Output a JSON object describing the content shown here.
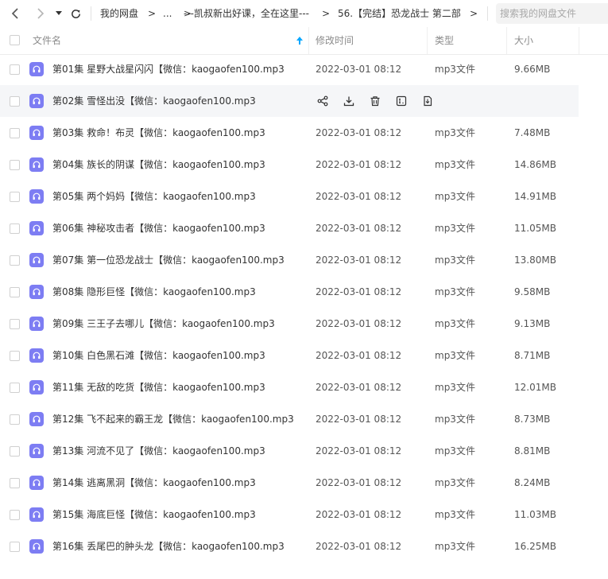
{
  "nav": {
    "breadcrumb": [
      {
        "label": "我的网盘"
      },
      {
        "label": "..."
      },
      {
        "label": "---凯叔新出好课，全在这里---"
      },
      {
        "label": "56.【完结】恐龙战士 第二部"
      }
    ],
    "separator": ">",
    "search_placeholder": "搜索我的网盘文件"
  },
  "table": {
    "columns": {
      "name": "文件名",
      "modified": "修改时间",
      "type": "类型",
      "size": "大小"
    },
    "sort": {
      "column": "name",
      "direction": "asc"
    },
    "hovered_row_index": 1,
    "hover_actions": [
      "share-icon",
      "download-icon",
      "delete-icon",
      "rename-icon",
      "more-icon"
    ],
    "rows": [
      {
        "name": "第01集 星野大战星闪闪【微信：kaogaofen100.mp3",
        "modified": "2022-03-01 08:12",
        "type": "mp3文件",
        "size": "9.66MB"
      },
      {
        "name": "第02集 雪怪出没【微信：kaogaofen100.mp3",
        "modified": "2022-03-01 08:12",
        "type": "mp3文件",
        "size": ""
      },
      {
        "name": "第03集 救命！布灵【微信：kaogaofen100.mp3",
        "modified": "2022-03-01 08:12",
        "type": "mp3文件",
        "size": "7.48MB"
      },
      {
        "name": "第04集 族长的阴谋【微信：kaogaofen100.mp3",
        "modified": "2022-03-01 08:12",
        "type": "mp3文件",
        "size": "14.86MB"
      },
      {
        "name": "第05集 两个妈妈【微信：kaogaofen100.mp3",
        "modified": "2022-03-01 08:12",
        "type": "mp3文件",
        "size": "14.91MB"
      },
      {
        "name": "第06集 神秘攻击者【微信：kaogaofen100.mp3",
        "modified": "2022-03-01 08:12",
        "type": "mp3文件",
        "size": "11.05MB"
      },
      {
        "name": "第07集 第一位恐龙战士【微信：kaogaofen100.mp3",
        "modified": "2022-03-01 08:12",
        "type": "mp3文件",
        "size": "13.80MB"
      },
      {
        "name": "第08集 隐形巨怪【微信：kaogaofen100.mp3",
        "modified": "2022-03-01 08:12",
        "type": "mp3文件",
        "size": "9.58MB"
      },
      {
        "name": "第09集 三王子去哪儿【微信：kaogaofen100.mp3",
        "modified": "2022-03-01 08:12",
        "type": "mp3文件",
        "size": "9.13MB"
      },
      {
        "name": "第10集 白色黑石滩【微信：kaogaofen100.mp3",
        "modified": "2022-03-01 08:12",
        "type": "mp3文件",
        "size": "8.71MB"
      },
      {
        "name": "第11集  无敌的吃货【微信：kaogaofen100.mp3",
        "modified": "2022-03-01 08:12",
        "type": "mp3文件",
        "size": "12.01MB"
      },
      {
        "name": "第12集 飞不起来的霸王龙【微信：kaogaofen100.mp3",
        "modified": "2022-03-01 08:12",
        "type": "mp3文件",
        "size": "8.73MB"
      },
      {
        "name": "第13集 河流不见了【微信：kaogaofen100.mp3",
        "modified": "2022-03-01 08:12",
        "type": "mp3文件",
        "size": "8.81MB"
      },
      {
        "name": "第14集 逃离黑洞【微信：kaogaofen100.mp3",
        "modified": "2022-03-01 08:12",
        "type": "mp3文件",
        "size": "8.24MB"
      },
      {
        "name": "第15集 海底巨怪【微信：kaogaofen100.mp3",
        "modified": "2022-03-01 08:12",
        "type": "mp3文件",
        "size": "11.03MB"
      },
      {
        "name": "第16集 丢尾巴的肿头龙【微信：kaogaofen100.mp3",
        "modified": "2022-03-01 08:12",
        "type": "mp3文件",
        "size": "16.25MB"
      }
    ]
  },
  "colors": {
    "accent": "#06a7ff",
    "file_icon": "#7d7df3",
    "hover_row": "#f5f6f8"
  }
}
